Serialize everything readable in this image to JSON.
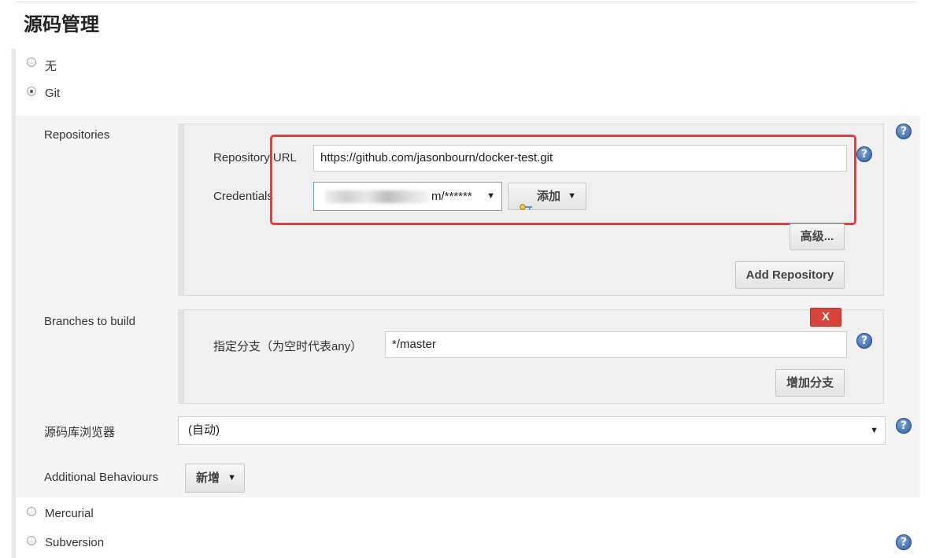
{
  "section": {
    "title": "源码管理"
  },
  "scm_options": [
    {
      "label": "无",
      "checked": false
    },
    {
      "label": "Git",
      "checked": true
    },
    {
      "label": "Mercurial",
      "checked": false
    },
    {
      "label": "Subversion",
      "checked": false
    }
  ],
  "git": {
    "repositories_label": "Repositories",
    "repository_url_label": "Repository URL",
    "repository_url_value": "https://github.com/jasonbourn/docker-test.git",
    "credentials_label": "Credentials",
    "credentials_value": "m/******",
    "add_credentials_label": "添加",
    "advanced_label": "高级...",
    "add_repository_label": "Add Repository",
    "branches_label": "Branches to build",
    "branch_specifier_label": "指定分支（为空时代表any）",
    "branch_specifier_value": "*/master",
    "delete_branch_label": "X",
    "add_branch_label": "增加分支",
    "repo_browser_label": "源码库浏览器",
    "repo_browser_value": "(自动)",
    "additional_behaviours_label": "Additional Behaviours",
    "new_behaviour_label": "新增"
  },
  "icons": {
    "help": "?",
    "caret": "▼",
    "key": "key-icon"
  },
  "colors": {
    "highlight_border": "#ff3333",
    "delete_button": "#d9443a",
    "help_icon": "#2f5fa4"
  }
}
